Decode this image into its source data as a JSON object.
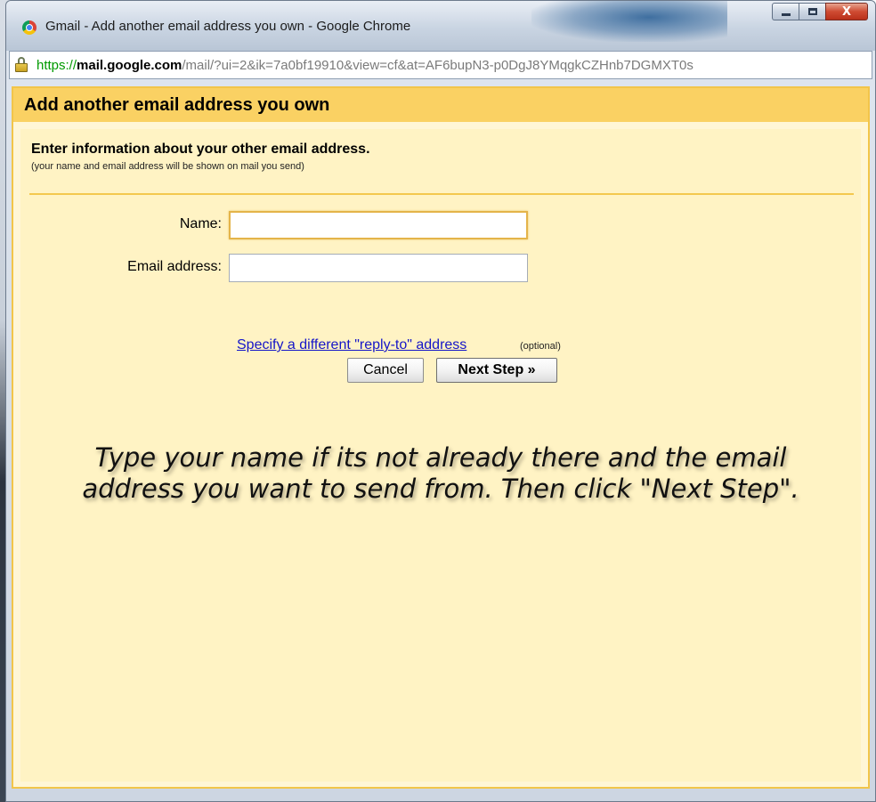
{
  "window": {
    "title": "Gmail - Add another email address you own - Google Chrome",
    "controls": {
      "minimize": "minimize",
      "maximize": "maximize",
      "close": "X"
    }
  },
  "addressbar": {
    "scheme": "https://",
    "host": "mail.google.com",
    "path": "/mail/?ui=2&ik=7a0bf19910&view=cf&at=AF6bupN3-p0DgJ8YMqgkCZHnb7DGMXT0s"
  },
  "dialog": {
    "header": "Add another email address you own",
    "section_title": "Enter information about your other email address.",
    "section_subtitle": "(your name and email address will be shown on mail you send)",
    "name_label": "Name:",
    "name_value": "",
    "email_label": "Email address:",
    "email_value": "",
    "reply_to_link": "Specify a different \"reply-to\" address",
    "optional_note": "(optional)",
    "cancel_button": "Cancel",
    "next_button": "Next Step »"
  },
  "instruction_text": "Type your name if its not already there and the email address you want to send from. Then click \"Next Step\".",
  "colors": {
    "header_bg": "#fad163",
    "content_bg": "#fff3c4",
    "link": "#1515c8",
    "secure_scheme": "#009a00"
  }
}
